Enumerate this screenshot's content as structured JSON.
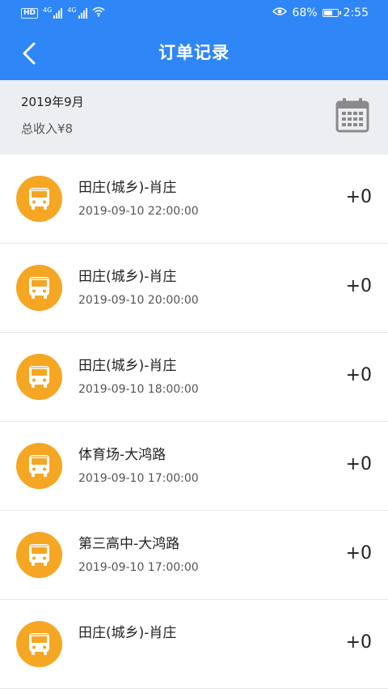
{
  "status_bar": {
    "hd_label": "HD",
    "network_1": "4G",
    "network_2": "4G",
    "battery_text": "68%",
    "battery_level": 0.68,
    "time": "2:55"
  },
  "header": {
    "title": "订单记录",
    "back_icon": "chevron-left-icon"
  },
  "summary": {
    "month": "2019年9月",
    "total_income": "总收入¥8",
    "calendar_icon": "calendar-icon"
  },
  "orders": [
    {
      "route": "田庄(城乡)-肖庄",
      "time": "2019-09-10 22:00:00",
      "amount": "+0"
    },
    {
      "route": "田庄(城乡)-肖庄",
      "time": "2019-09-10 20:00:00",
      "amount": "+0"
    },
    {
      "route": "田庄(城乡)-肖庄",
      "time": "2019-09-10 18:00:00",
      "amount": "+0"
    },
    {
      "route": "体育场-大鸿路",
      "time": "2019-09-10 17:00:00",
      "amount": "+0"
    },
    {
      "route": "第三高中-大鸿路",
      "time": "2019-09-10 17:00:00",
      "amount": "+0"
    },
    {
      "route": "田庄(城乡)-肖庄",
      "time": "",
      "amount": "+0"
    }
  ],
  "theme": {
    "primary": "#2F86F6",
    "summary_bg": "#EDEEF1",
    "icon_circle": "#F5A623"
  }
}
